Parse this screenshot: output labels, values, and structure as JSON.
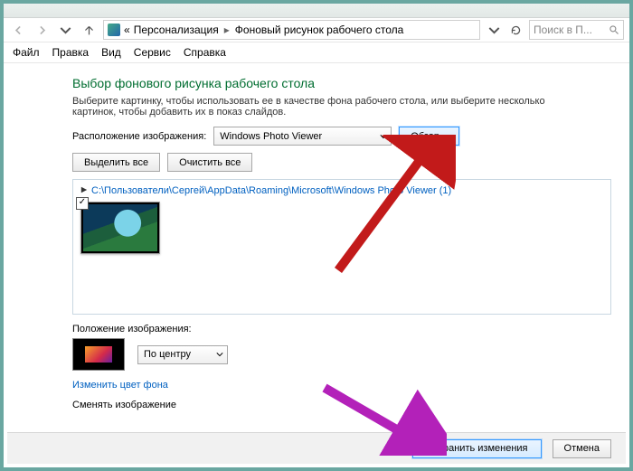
{
  "breadcrumb": {
    "seg1": "Персонализация",
    "seg2": "Фоновый рисунок рабочего стола"
  },
  "search": {
    "placeholder": "Поиск в П..."
  },
  "menubar": {
    "file": "Файл",
    "edit": "Правка",
    "view": "Вид",
    "service": "Сервис",
    "help": "Справка"
  },
  "page": {
    "title": "Выбор фонового рисунка рабочего стола",
    "description": "Выберите картинку, чтобы использовать ее в качестве фона рабочего стола, или выберите несколько картинок, чтобы добавить их в показ слайдов.",
    "location_label": "Расположение изображения:",
    "location_value": "Windows Photo Viewer",
    "browse": "Обзор...",
    "select_all": "Выделить все",
    "clear_all": "Очистить все",
    "group_path": "C:\\Пользователи\\Сергей\\AppData\\Roaming\\Microsoft\\Windows Photo Viewer (1)",
    "position_label": "Положение изображения:",
    "position_value": "По центру",
    "change_color": "Изменить цвет фона",
    "change_image": "Сменять изображение"
  },
  "footer": {
    "save": "Сохранить изменения",
    "cancel": "Отмена"
  }
}
